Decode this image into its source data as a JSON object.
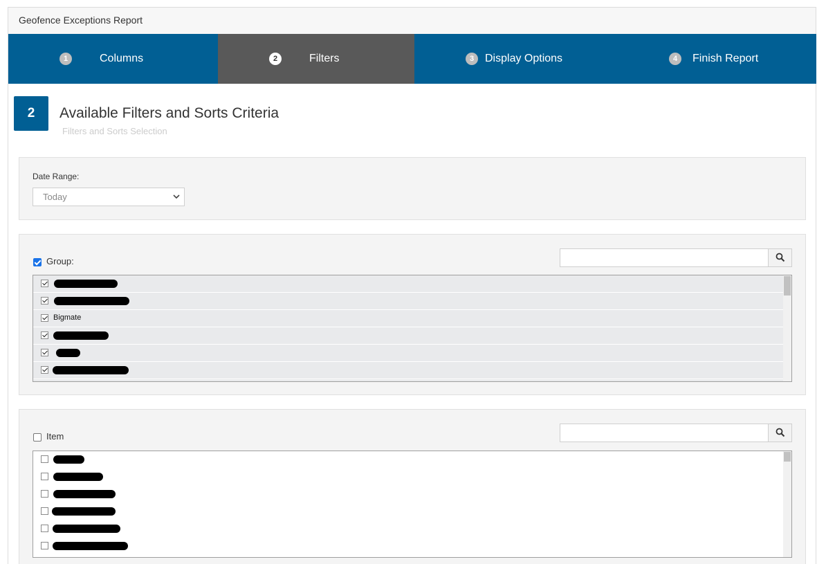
{
  "report": {
    "title": "Geofence Exceptions Report"
  },
  "wizard": {
    "steps": [
      {
        "num": "1",
        "label": "Columns"
      },
      {
        "num": "2",
        "label": "Filters"
      },
      {
        "num": "3",
        "label": "Display Options"
      },
      {
        "num": "4",
        "label": "Finish Report"
      }
    ],
    "active_step": "2"
  },
  "section": {
    "number": "2",
    "title": "Available Filters and Sorts Criteria",
    "subtitle": "Filters and Sorts Selection"
  },
  "date_range": {
    "label": "Date Range:",
    "selected": "Today"
  },
  "group_filter": {
    "label": "Group:",
    "checked": true,
    "items": [
      {
        "text": "",
        "checked": true
      },
      {
        "text": "",
        "checked": true
      },
      {
        "text": "Bigmate",
        "checked": true
      },
      {
        "text": "",
        "checked": true
      },
      {
        "text": "",
        "checked": true
      },
      {
        "text": "",
        "checked": true
      }
    ]
  },
  "item_filter": {
    "label": "Item",
    "checked": false,
    "items": [
      {
        "text": "",
        "checked": false
      },
      {
        "text": "",
        "checked": false
      },
      {
        "text": "",
        "checked": false
      },
      {
        "text": "",
        "checked": false
      },
      {
        "text": "",
        "checked": false
      },
      {
        "text": "",
        "checked": false
      }
    ]
  },
  "icons": {
    "search": "search-icon",
    "dropdown": "chevron-down-icon"
  },
  "colors": {
    "primary": "#015f94",
    "active_step": "#595959"
  }
}
